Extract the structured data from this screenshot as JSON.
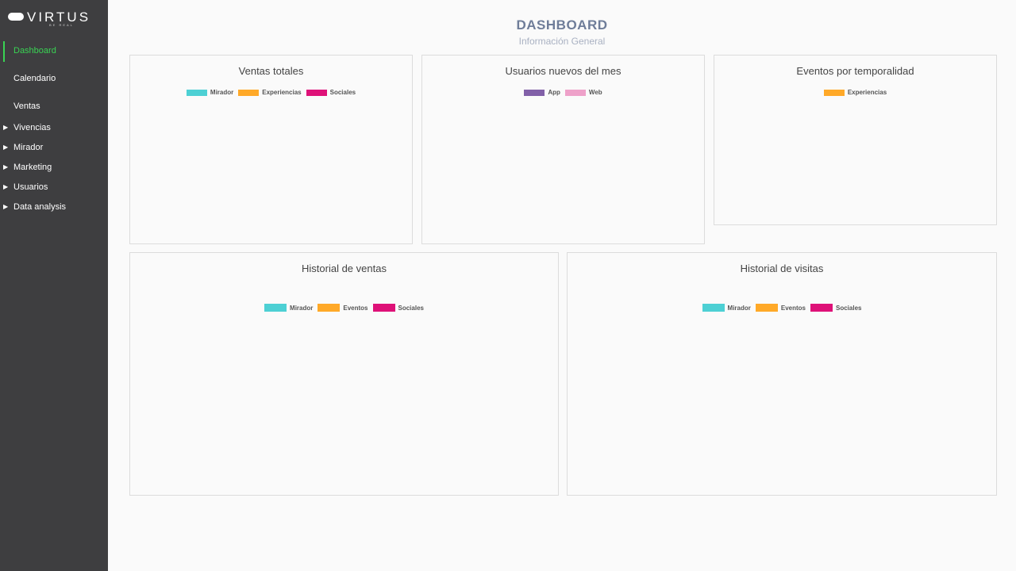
{
  "brand": {
    "name": "VIRTUS",
    "tagline": "BE REAL"
  },
  "sidebar": {
    "items": [
      {
        "label": "Dashboard",
        "active": true,
        "expandable": false
      },
      {
        "label": "Calendario",
        "active": false,
        "expandable": false
      },
      {
        "label": "Ventas",
        "active": false,
        "expandable": false
      },
      {
        "label": "Vivencias",
        "active": false,
        "expandable": true
      },
      {
        "label": "Mirador",
        "active": false,
        "expandable": true
      },
      {
        "label": "Marketing",
        "active": false,
        "expandable": true
      },
      {
        "label": "Usuarios",
        "active": false,
        "expandable": true
      },
      {
        "label": "Data analysis",
        "active": false,
        "expandable": true
      }
    ],
    "arrow_glyph": "▶"
  },
  "header": {
    "title": "DASHBOARD",
    "subtitle": "Información General"
  },
  "colors": {
    "cyan": "#4dd0d4",
    "orange": "#ffa928",
    "magenta": "#de1178",
    "purple": "#8160a8",
    "pink": "#eea1c9",
    "accent": "#39d353"
  },
  "cards": {
    "ventas_totales": {
      "title": "Ventas totales",
      "legend": [
        {
          "label": "Mirador",
          "color": "#4dd0d4"
        },
        {
          "label": "Experiencias",
          "color": "#ffa928"
        },
        {
          "label": "Sociales",
          "color": "#de1178"
        }
      ]
    },
    "usuarios_nuevos": {
      "title": "Usuarios nuevos del mes",
      "legend": [
        {
          "label": "App",
          "color": "#8160a8"
        },
        {
          "label": "Web",
          "color": "#eea1c9"
        }
      ]
    },
    "eventos_temporalidad": {
      "title": "Eventos por temporalidad",
      "legend": [
        {
          "label": "Experiencias",
          "color": "#ffa928"
        }
      ]
    },
    "historial_ventas": {
      "title": "Historial de ventas",
      "legend": [
        {
          "label": "Mirador",
          "color": "#4dd0d4"
        },
        {
          "label": "Eventos",
          "color": "#ffa928"
        },
        {
          "label": "Sociales",
          "color": "#de1178"
        }
      ]
    },
    "historial_visitas": {
      "title": "Historial de visitas",
      "legend": [
        {
          "label": "Mirador",
          "color": "#4dd0d4"
        },
        {
          "label": "Eventos",
          "color": "#ffa928"
        },
        {
          "label": "Sociales",
          "color": "#de1178"
        }
      ]
    }
  }
}
